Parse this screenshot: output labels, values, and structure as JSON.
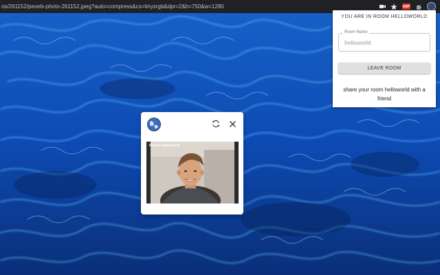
{
  "browser": {
    "url": "os/261152/pexels-photo-261152.jpeg?auto=compress&cs=tinysrgb&dpr=2&h=750&w=1280",
    "icons": [
      "camera-icon",
      "star-icon",
      "adblock-icon",
      "puzzle-icon",
      "extension-icon"
    ],
    "adblock_badge": "ABP"
  },
  "room_panel": {
    "title": "YOU ARE IN ROOM HELLOWORLD",
    "field_label": "Room Name",
    "field_value": "helloworld",
    "leave_button": "LEAVE ROOM",
    "share_text": "share your room helloworld with a friend"
  },
  "call_card": {
    "video_label": "Room helloworld",
    "icons": [
      "globe-icon",
      "refresh-icon",
      "close-icon"
    ]
  },
  "colors": {
    "water_dark": "#0b3d8f",
    "water_light": "#4fb3ff",
    "panel_bg": "#ffffff",
    "button_bg": "#e0e0e0"
  }
}
